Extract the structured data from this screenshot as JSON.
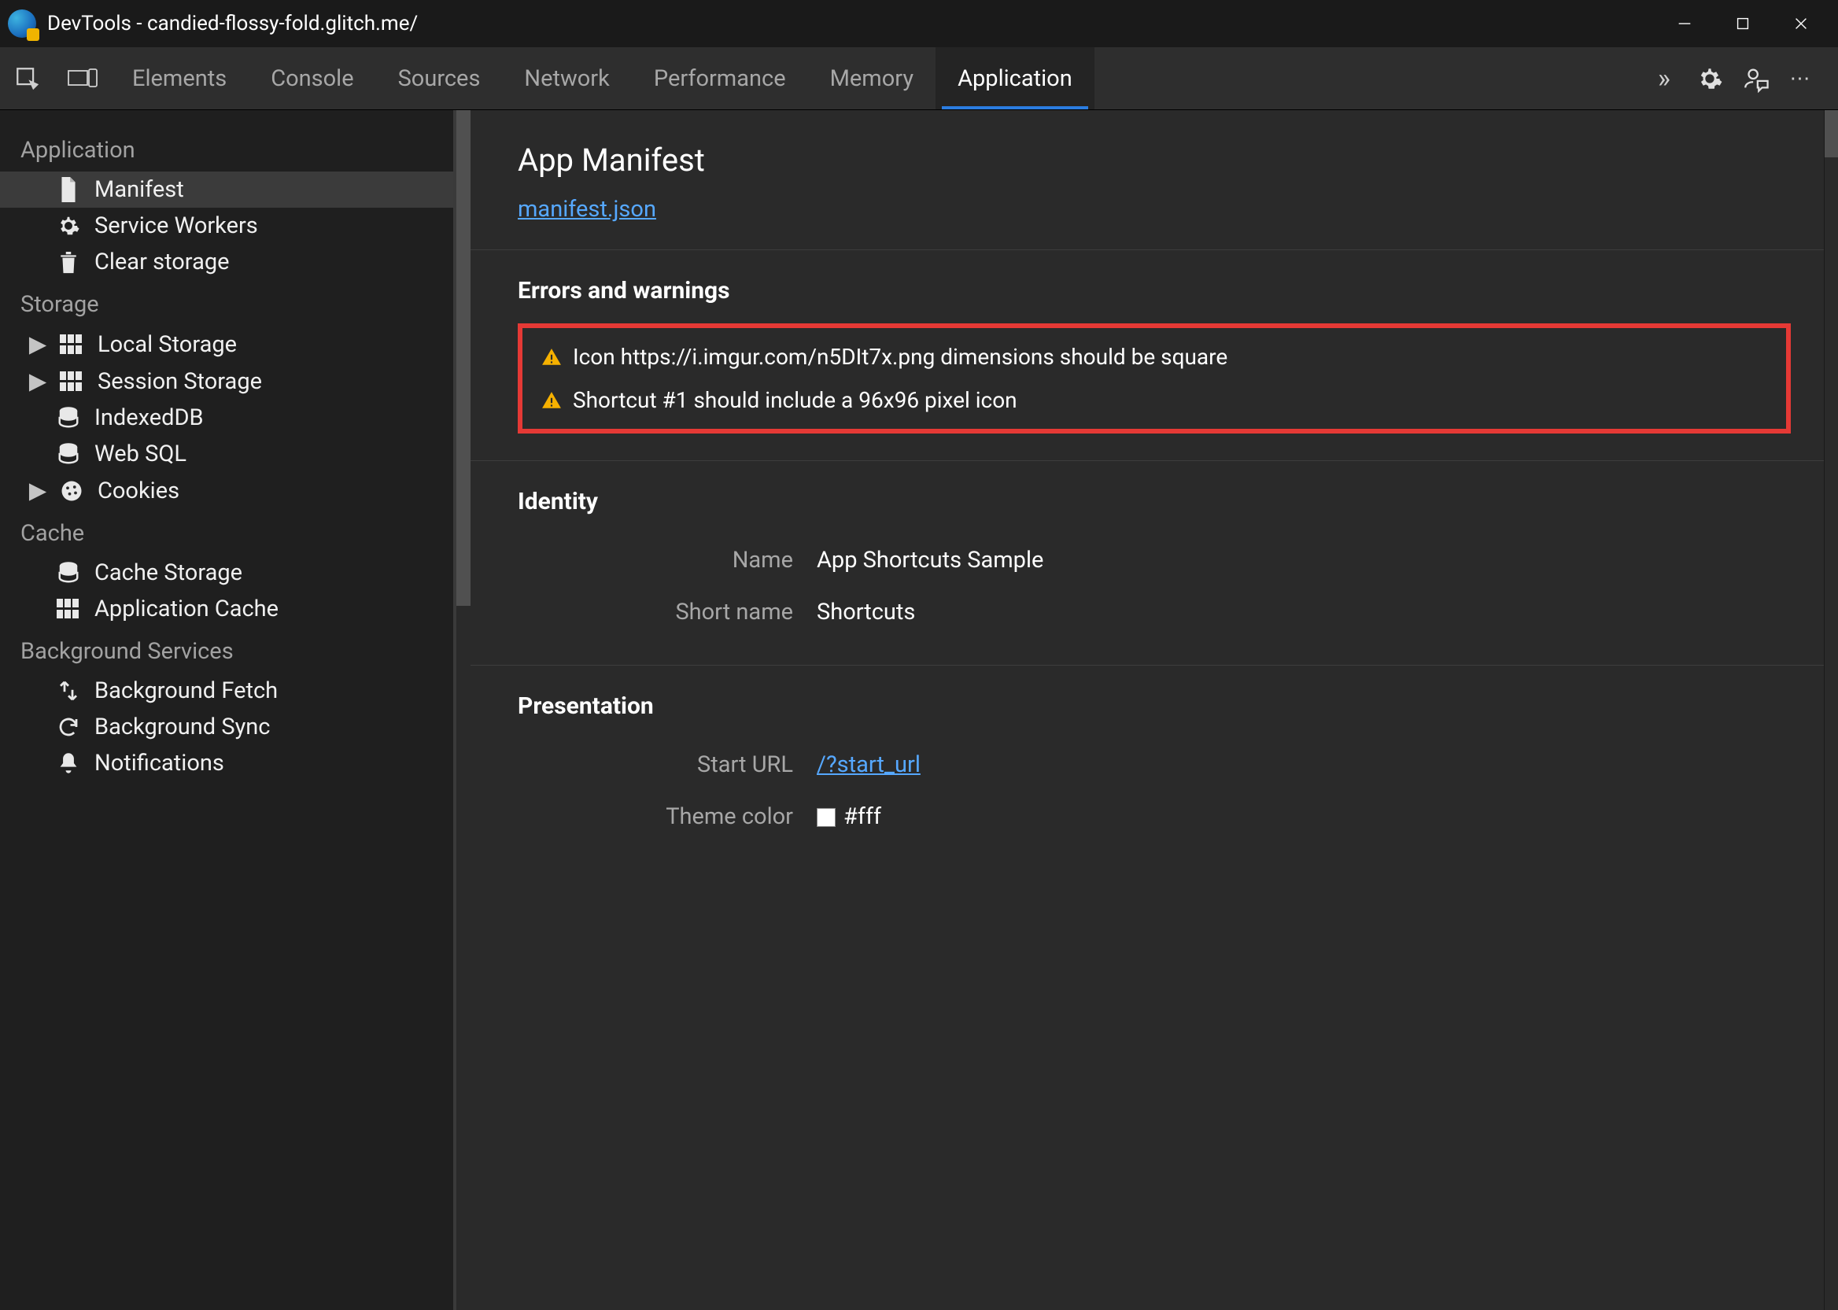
{
  "window": {
    "title": "DevTools - candied-flossy-fold.glitch.me/"
  },
  "tabs": [
    {
      "label": "Elements",
      "active": false
    },
    {
      "label": "Console",
      "active": false
    },
    {
      "label": "Sources",
      "active": false
    },
    {
      "label": "Network",
      "active": false
    },
    {
      "label": "Performance",
      "active": false
    },
    {
      "label": "Memory",
      "active": false
    },
    {
      "label": "Application",
      "active": true
    }
  ],
  "more_tabs_glyph": "»",
  "sidebar": {
    "sections": [
      {
        "title": "Application",
        "items": [
          {
            "icon": "file-icon",
            "label": "Manifest",
            "selected": true,
            "expandable": false
          },
          {
            "icon": "gear-icon",
            "label": "Service Workers",
            "selected": false,
            "expandable": false
          },
          {
            "icon": "trash-icon",
            "label": "Clear storage",
            "selected": false,
            "expandable": false
          }
        ]
      },
      {
        "title": "Storage",
        "items": [
          {
            "icon": "grid-icon",
            "label": "Local Storage",
            "selected": false,
            "expandable": true
          },
          {
            "icon": "grid-icon",
            "label": "Session Storage",
            "selected": false,
            "expandable": true
          },
          {
            "icon": "database-icon",
            "label": "IndexedDB",
            "selected": false,
            "expandable": false
          },
          {
            "icon": "database-icon",
            "label": "Web SQL",
            "selected": false,
            "expandable": false
          },
          {
            "icon": "cookie-icon",
            "label": "Cookies",
            "selected": false,
            "expandable": true
          }
        ]
      },
      {
        "title": "Cache",
        "items": [
          {
            "icon": "database-icon",
            "label": "Cache Storage",
            "selected": false,
            "expandable": false
          },
          {
            "icon": "grid-icon",
            "label": "Application Cache",
            "selected": false,
            "expandable": false
          }
        ]
      },
      {
        "title": "Background Services",
        "items": [
          {
            "icon": "fetch-icon",
            "label": "Background Fetch",
            "selected": false,
            "expandable": false
          },
          {
            "icon": "sync-icon",
            "label": "Background Sync",
            "selected": false,
            "expandable": false
          },
          {
            "icon": "bell-icon",
            "label": "Notifications",
            "selected": false,
            "expandable": false
          }
        ]
      }
    ]
  },
  "manifest": {
    "heading": "App Manifest",
    "link_text": "manifest.json",
    "errors_heading": "Errors and warnings",
    "warnings": [
      "Icon https://i.imgur.com/n5DIt7x.png dimensions should be square",
      "Shortcut #1 should include a 96x96 pixel icon"
    ],
    "identity_heading": "Identity",
    "identity": {
      "name_label": "Name",
      "name_value": "App Shortcuts Sample",
      "short_name_label": "Short name",
      "short_name_value": "Shortcuts"
    },
    "presentation_heading": "Presentation",
    "presentation": {
      "start_url_label": "Start URL",
      "start_url_value": "/?start_url",
      "theme_color_label": "Theme color",
      "theme_color_value": "#fff"
    }
  }
}
